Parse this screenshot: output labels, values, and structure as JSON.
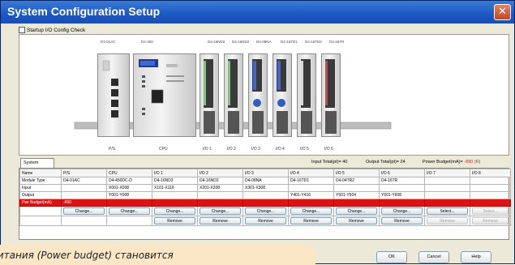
{
  "window": {
    "title": "System Configuration Setup",
    "close_glyph": "✕"
  },
  "startup_check": {
    "label": "Startup I/O Config Check",
    "checked": false
  },
  "rack": {
    "modules": [
      {
        "slot": "P/S",
        "model": "D4-01AC"
      },
      {
        "slot": "CPU",
        "model": "D4-450"
      },
      {
        "slot": "I/O 1",
        "model": "D4-16ND2"
      },
      {
        "slot": "I/O 2",
        "model": "D4-16ND2"
      },
      {
        "slot": "I/O 3",
        "model": "D4-08NA"
      },
      {
        "slot": "I/O 4",
        "model": "D4-16TD1"
      },
      {
        "slot": "I/O 5",
        "model": "D4-16TD2"
      },
      {
        "slot": "I/O 6",
        "model": "D4-16TR"
      }
    ]
  },
  "tabs": [
    {
      "label": "System",
      "active": true
    }
  ],
  "totals": {
    "input": "Input Total(pt)= 40",
    "output": "Output Total(pt)= 24",
    "power_label": "Power Budget(mA)=",
    "power_value": "-890 (R)",
    "power_color": "#e02020"
  },
  "grid": {
    "row_labels": [
      "Name",
      "Module Type",
      "Input",
      "Output",
      "Pwr Budget(mA)"
    ],
    "columns": [
      {
        "name": "P/S",
        "type": "D4-01AC",
        "input": "",
        "output": "",
        "budget": "",
        "change": "Change...",
        "remove": "",
        "change_enabled": true,
        "remove_enabled": false
      },
      {
        "name": "CPU",
        "type": "D4-450DC-D",
        "input": "X001-X008",
        "output": "Y001-Y008",
        "budget": "",
        "change": "Change...",
        "remove": "",
        "change_enabled": true,
        "remove_enabled": false
      },
      {
        "name": "I/O 1",
        "type": "D4-16ND2",
        "input": "X101-X116",
        "output": "",
        "budget": "",
        "change": "Change...",
        "remove": "Remove",
        "change_enabled": true,
        "remove_enabled": true
      },
      {
        "name": "I/O 2",
        "type": "D4-16ND2",
        "input": "X201-X208",
        "output": "",
        "budget": "",
        "change": "Change...",
        "remove": "Remove",
        "change_enabled": true,
        "remove_enabled": true
      },
      {
        "name": "I/O 3",
        "type": "D4-08NA",
        "input": "X301-X308",
        "output": "",
        "budget": "",
        "change": "Change...",
        "remove": "Remove",
        "change_enabled": true,
        "remove_enabled": true
      },
      {
        "name": "I/O 4",
        "type": "D4-16TD1",
        "input": "",
        "output": "Y401-Y416",
        "budget": "",
        "change": "Change...",
        "remove": "Remove",
        "change_enabled": true,
        "remove_enabled": true
      },
      {
        "name": "I/O 5",
        "type": "D4-04TR2",
        "input": "",
        "output": "Y501-Y504",
        "budget": "",
        "change": "Change...",
        "remove": "Remove",
        "change_enabled": true,
        "remove_enabled": true
      },
      {
        "name": "I/O 6",
        "type": "D4-16TR",
        "input": "",
        "output": "Y601-Y608",
        "budget": "",
        "change": "Change...",
        "remove": "Remove",
        "change_enabled": true,
        "remove_enabled": true
      },
      {
        "name": "I/O 7",
        "type": "",
        "input": "",
        "output": "",
        "budget": "",
        "change": "Select...",
        "remove": "Remove",
        "change_enabled": true,
        "remove_enabled": false
      },
      {
        "name": "I/O 8",
        "type": "",
        "input": "",
        "output": "",
        "budget": "",
        "change": "Select...",
        "remove": "Remove",
        "change_enabled": false,
        "remove_enabled": false
      }
    ],
    "budget_first_cell": "-890"
  },
  "caption": {
    "text": "питания (Power budget) становится"
  },
  "buttons": {
    "ok": "OK",
    "cancel": "Cancel",
    "help": "Help"
  }
}
